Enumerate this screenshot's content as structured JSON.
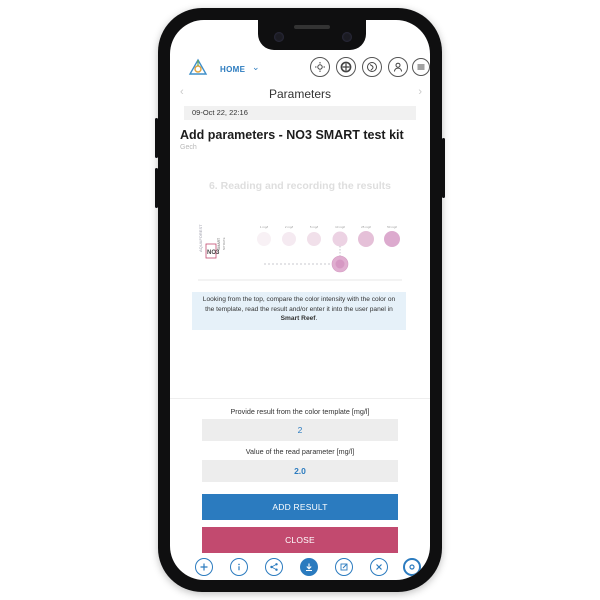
{
  "header": {
    "home_label": "HOME",
    "home_chevron": "chevron-down-icon",
    "icons": [
      "sun-icon",
      "filter-icon",
      "globe-icon",
      "user-icon",
      "menu-icon"
    ]
  },
  "page": {
    "title": "Parameters",
    "date": "09-Oct 22, 22:16",
    "heading": "Add parameters - NO3 SMART test kit",
    "subheading": "Gech",
    "step_title": "6. Reading and recording the results"
  },
  "template": {
    "brand": "AQUAFOREST",
    "kit_code": "NO3",
    "kit_name": "SMART",
    "kit_sub": "NITRATE",
    "scale_labels": [
      "1 mg/l",
      "2 mg/l",
      "5 mg/l",
      "10 mg/l",
      "25 mg/l",
      "50 mg/l"
    ]
  },
  "info": {
    "text_before": "Looking from the top, compare the color intensity with the color on the template, read the result and/or enter it into the user panel in ",
    "highlight": "Smart Reef",
    "text_after": "."
  },
  "form": {
    "result_label": "Provide result from the color template [mg/l]",
    "result_value": "2",
    "read_label": "Value of the read parameter  [mg/l]",
    "read_value": "2.0"
  },
  "buttons": {
    "add_result": "ADD RESULT",
    "close": "CLOSE"
  },
  "bottom_icons": [
    "plus-icon",
    "info-icon",
    "share-icon",
    "download-icon",
    "edit-icon",
    "close-icon",
    "settings-icon"
  ],
  "colors": {
    "primary_blue": "#2b7bbf",
    "close_pink": "#c24a6f",
    "info_bg": "#e6f1f9",
    "swatch_pink": "#e0aed0"
  }
}
